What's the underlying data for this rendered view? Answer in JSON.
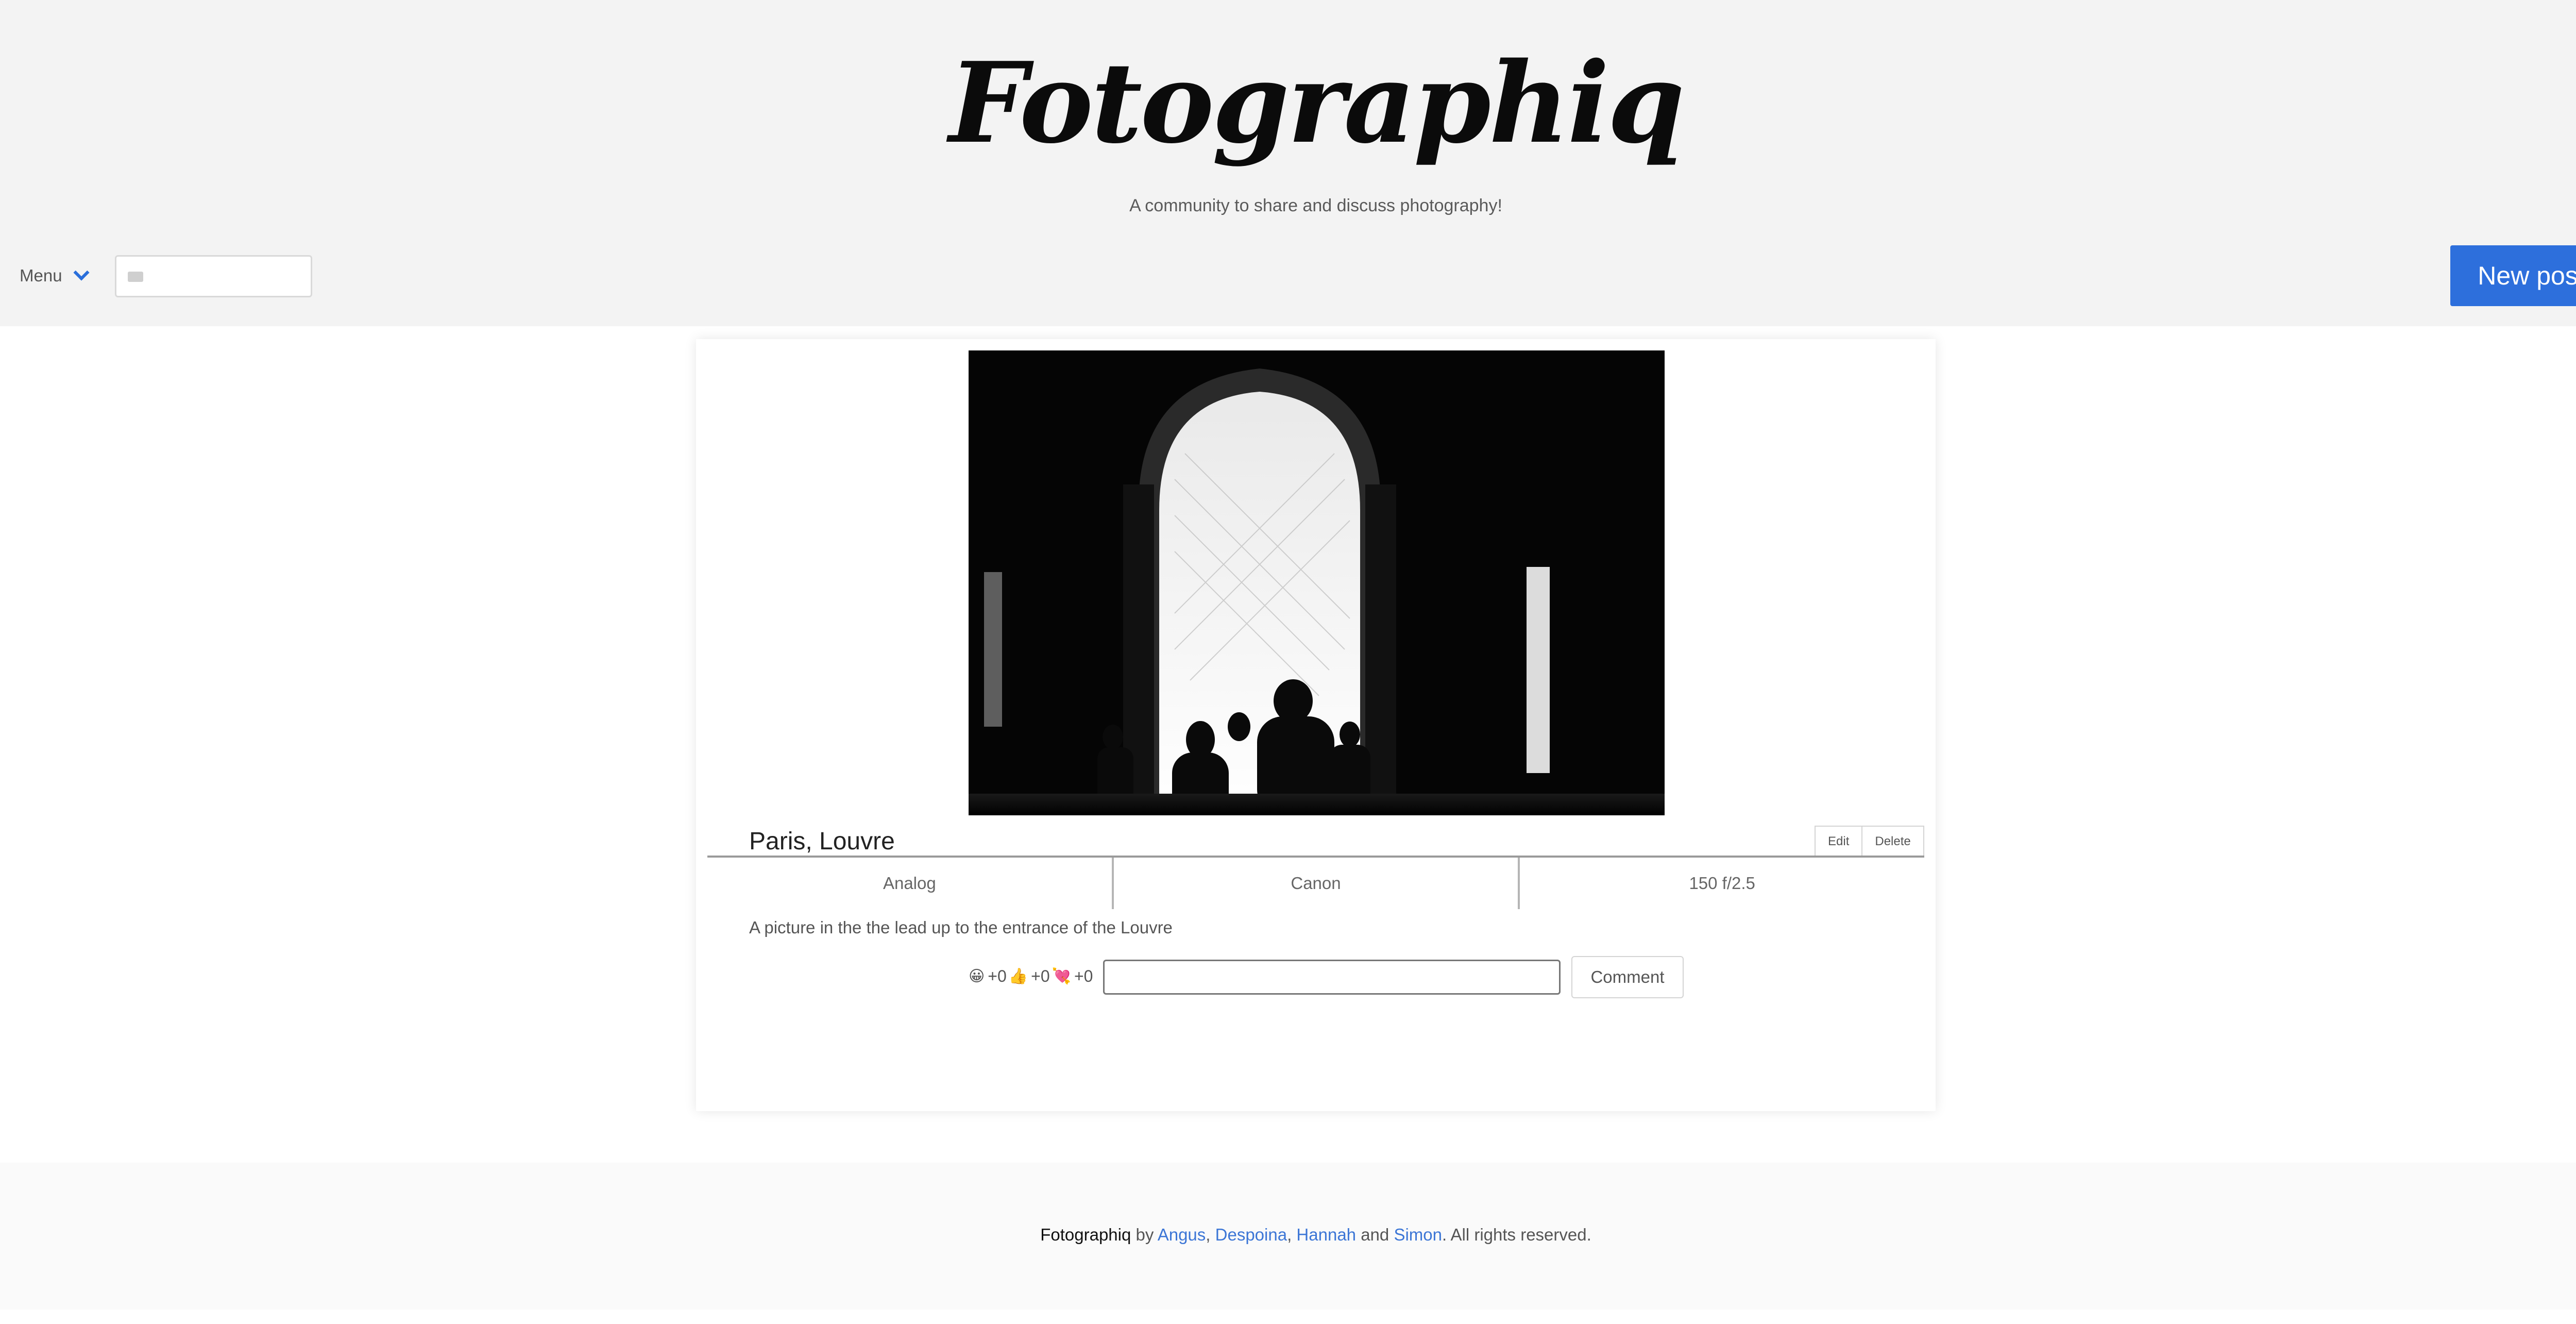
{
  "header": {
    "logo": "Fotographiq",
    "tagline": "A community to share and discuss photography!",
    "menu_label": "Menu",
    "search_value": "",
    "new_post_label": "New post"
  },
  "post": {
    "title": "Paris, Louvre",
    "edit_label": "Edit",
    "delete_label": "Delete",
    "meta": [
      "Analog",
      "Canon",
      "150 f/2.5"
    ],
    "description": "A picture in the the lead up to the entrance of the Louvre",
    "reactions": [
      {
        "icon": "grinning-face-icon",
        "emoji": "😀",
        "count": "+0"
      },
      {
        "icon": "thumbs-up-icon",
        "emoji": "👍",
        "count": "+0"
      },
      {
        "icon": "heart-arrow-icon",
        "emoji": "💘",
        "count": "+0"
      }
    ],
    "comment_value": "",
    "comment_button_label": "Comment"
  },
  "footer": {
    "brand": "Fotographiq",
    "by": " by ",
    "authors": [
      "Angus",
      "Despoina",
      "Hannah",
      "Simon"
    ],
    "sep1": ", ",
    "sep2": ", ",
    "and": " and ",
    "rights": ". All rights reserved."
  },
  "colors": {
    "accent": "#2d6fdc",
    "link": "#3c76d6",
    "header_bg": "#f3f3f3"
  }
}
